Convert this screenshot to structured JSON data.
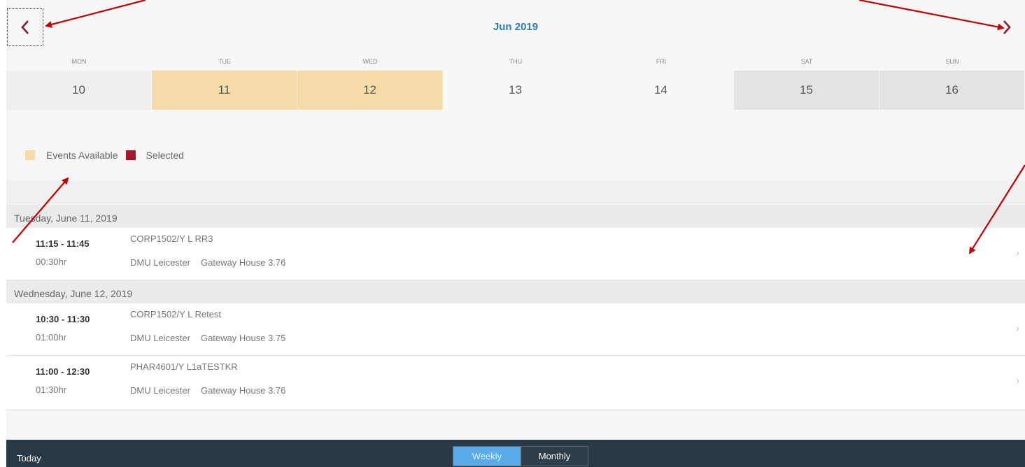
{
  "header": {
    "month_title": "Jun 2019",
    "prev_icon": "chevron-left-icon",
    "next_icon": "chevron-right-icon"
  },
  "week": {
    "day_names": [
      "MON",
      "TUE",
      "WED",
      "THU",
      "FRI",
      "SAT",
      "SUN"
    ],
    "day_numbers": [
      "10",
      "11",
      "12",
      "13",
      "14",
      "15",
      "16"
    ]
  },
  "legend": {
    "available_label": "Events Available",
    "selected_label": "Selected",
    "available_color": "#f5dba8",
    "selected_color": "#a3172f"
  },
  "events": {
    "groups": [
      {
        "date": "Tuesday, June 11, 2019",
        "items": [
          {
            "time": "11:15 - 11:45",
            "duration": "00:30hr",
            "title": "CORP1502/Y L RR3",
            "campus": "DMU Leicester",
            "room": "Gateway House 3.76"
          }
        ]
      },
      {
        "date": "Wednesday, June 12, 2019",
        "items": [
          {
            "time": "10:30 - 11:30",
            "duration": "01:00hr",
            "title": "CORP1502/Y L Retest",
            "campus": "DMU Leicester",
            "room": "Gateway House 3.75"
          },
          {
            "time": "11:00 - 12:30",
            "duration": "01:30hr",
            "title": "PHAR4601/Y L1aTESTKR",
            "campus": "DMU Leicester",
            "room": "Gateway House 3.76"
          }
        ]
      }
    ]
  },
  "footer": {
    "today_label": "Today",
    "weekly_label": "Weekly",
    "monthly_label": "Monthly"
  },
  "colors": {
    "accent": "#2a7eb4",
    "footer_bg": "#2a3946",
    "annotation_arrow": "#c00000"
  }
}
